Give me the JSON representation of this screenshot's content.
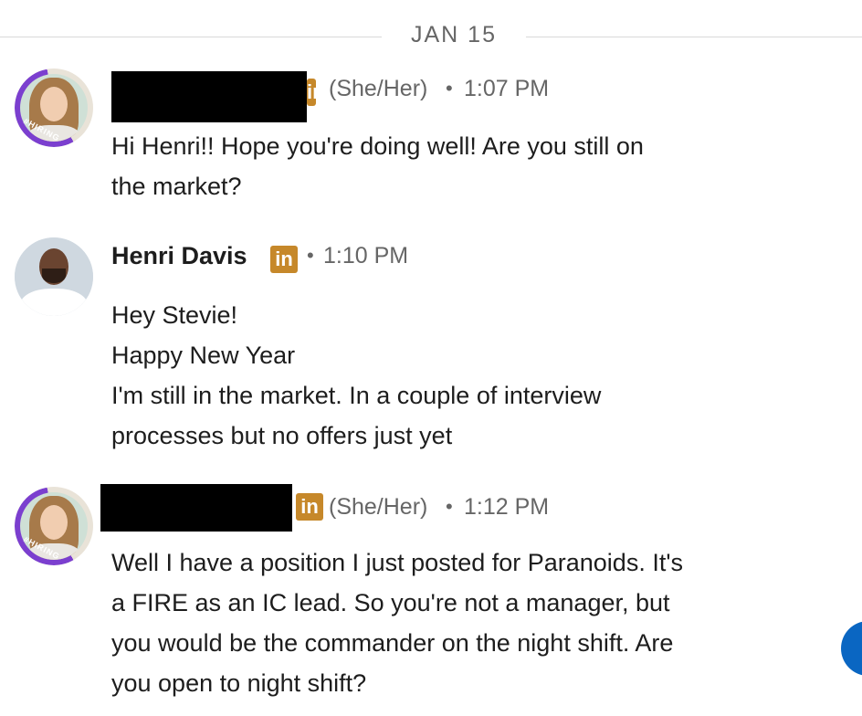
{
  "date_divider": "JAN 15",
  "messages": [
    {
      "sender_name": "",
      "pronouns": "(She/Her)",
      "separator": "•",
      "time": "1:07 PM",
      "badge": "in",
      "hiring_label": "#HIRING",
      "lines": [
        "Hi Henri!! Hope you're doing well! Are you still on",
        "the market?"
      ]
    },
    {
      "sender_name": "Henri Davis",
      "pronouns": "",
      "separator": "•",
      "time": "1:10 PM",
      "badge": "in",
      "lines": [
        "Hey Stevie!",
        "Happy New Year",
        "I'm still in the market. In a couple of interview",
        "processes but no offers just yet"
      ]
    },
    {
      "sender_name": "",
      "pronouns": "(She/Her)",
      "separator": "•",
      "time": "1:12 PM",
      "badge": "in",
      "hiring_label": "#HIRING",
      "lines": [
        "Well I have a position I just posted for Paranoids. It's",
        "a FIRE as an IC lead. So you're not a manager, but",
        "you would be the commander on the night shift. Are",
        "you open to night shift?"
      ]
    }
  ],
  "colors": {
    "linkedin_badge": "#c6882a",
    "hiring_ring": "#7b3fcf",
    "fab": "#0a66c2"
  },
  "icons": [
    "linkedin-badge-icon",
    "compose-fab-icon"
  ]
}
